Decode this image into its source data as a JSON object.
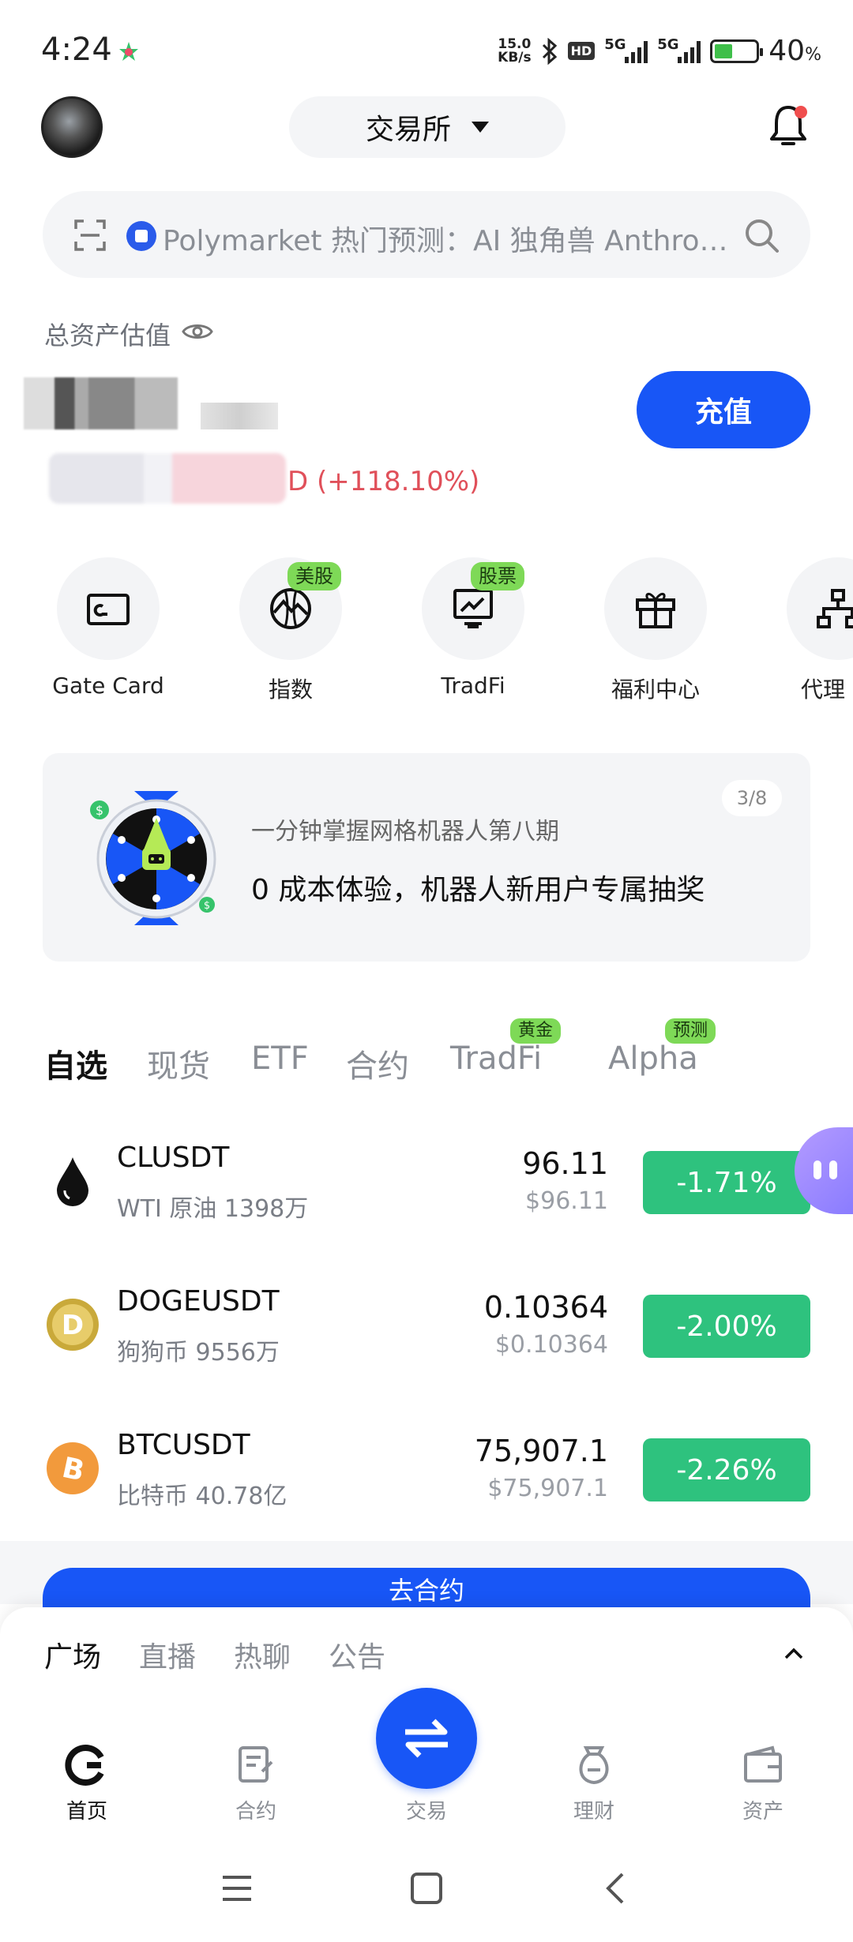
{
  "status_bar": {
    "time": "4:24",
    "net_speed_value": "15.0",
    "net_speed_unit": "KB/s",
    "hd_label": "HD",
    "sim1_label": "5G",
    "sim2_label": "5G",
    "battery_pct": "40",
    "battery_unit": "%"
  },
  "header": {
    "exchange_label": "交易所"
  },
  "search": {
    "placeholder": "Polymarket 热门预测：AI 独角兽 Anthropic…"
  },
  "assets": {
    "label": "总资产估值",
    "pnl_suffix": "D (+118.10%)",
    "deposit_label": "充值"
  },
  "shortcuts": [
    {
      "label": "Gate Card",
      "icon": "card-icon",
      "tag": ""
    },
    {
      "label": "指数",
      "icon": "index-globe-icon",
      "tag": "美股"
    },
    {
      "label": "TradFi",
      "icon": "chart-board-icon",
      "tag": "股票"
    },
    {
      "label": "福利中心",
      "icon": "gift-icon",
      "tag": ""
    },
    {
      "label": "代理",
      "icon": "org-chart-icon",
      "tag": ""
    }
  ],
  "banner": {
    "page": "3/8",
    "subtitle": "一分钟掌握网格机器人第八期",
    "title": "0 成本体验，机器人新用户专属抽奖",
    "coin_symbol": "$"
  },
  "market_tabs": [
    {
      "label": "自选",
      "tag": ""
    },
    {
      "label": "现货",
      "tag": ""
    },
    {
      "label": "ETF",
      "tag": ""
    },
    {
      "label": "合约",
      "tag": ""
    },
    {
      "label": "TradFi",
      "tag": "黄金"
    },
    {
      "label": "Alpha",
      "tag": "预测"
    }
  ],
  "rows": [
    {
      "symbol": "CLUSDT",
      "subname": "WTI 原油  1398万",
      "price": "96.11",
      "price_fiat": "$96.11",
      "change": "-1.71%",
      "icon": "oil-drop-icon"
    },
    {
      "symbol": "DOGEUSDT",
      "subname": "狗狗币  9556万",
      "price": "0.10364",
      "price_fiat": "$0.10364",
      "change": "-2.00%",
      "icon": "doge-icon"
    },
    {
      "symbol": "BTCUSDT",
      "subname": "比特币  40.78亿",
      "price": "75,907.1",
      "price_fiat": "$75,907.1",
      "change": "-2.26%",
      "icon": "bitcoin-icon"
    }
  ],
  "go_contract_label": "去合约",
  "sheet_tabs": [
    "广场",
    "直播",
    "热聊",
    "公告"
  ],
  "bottom_nav": [
    {
      "label": "首页",
      "icon": "home-icon"
    },
    {
      "label": "合约",
      "icon": "contract-icon"
    },
    {
      "label": "交易",
      "icon": "swap-icon"
    },
    {
      "label": "理财",
      "icon": "finance-icon"
    },
    {
      "label": "资产",
      "icon": "wallet-icon"
    }
  ],
  "colors": {
    "brand_blue": "#1856f6",
    "down_green": "#2ec27e",
    "pnl_red": "#e0505a",
    "tag_green": "#7ed957"
  }
}
